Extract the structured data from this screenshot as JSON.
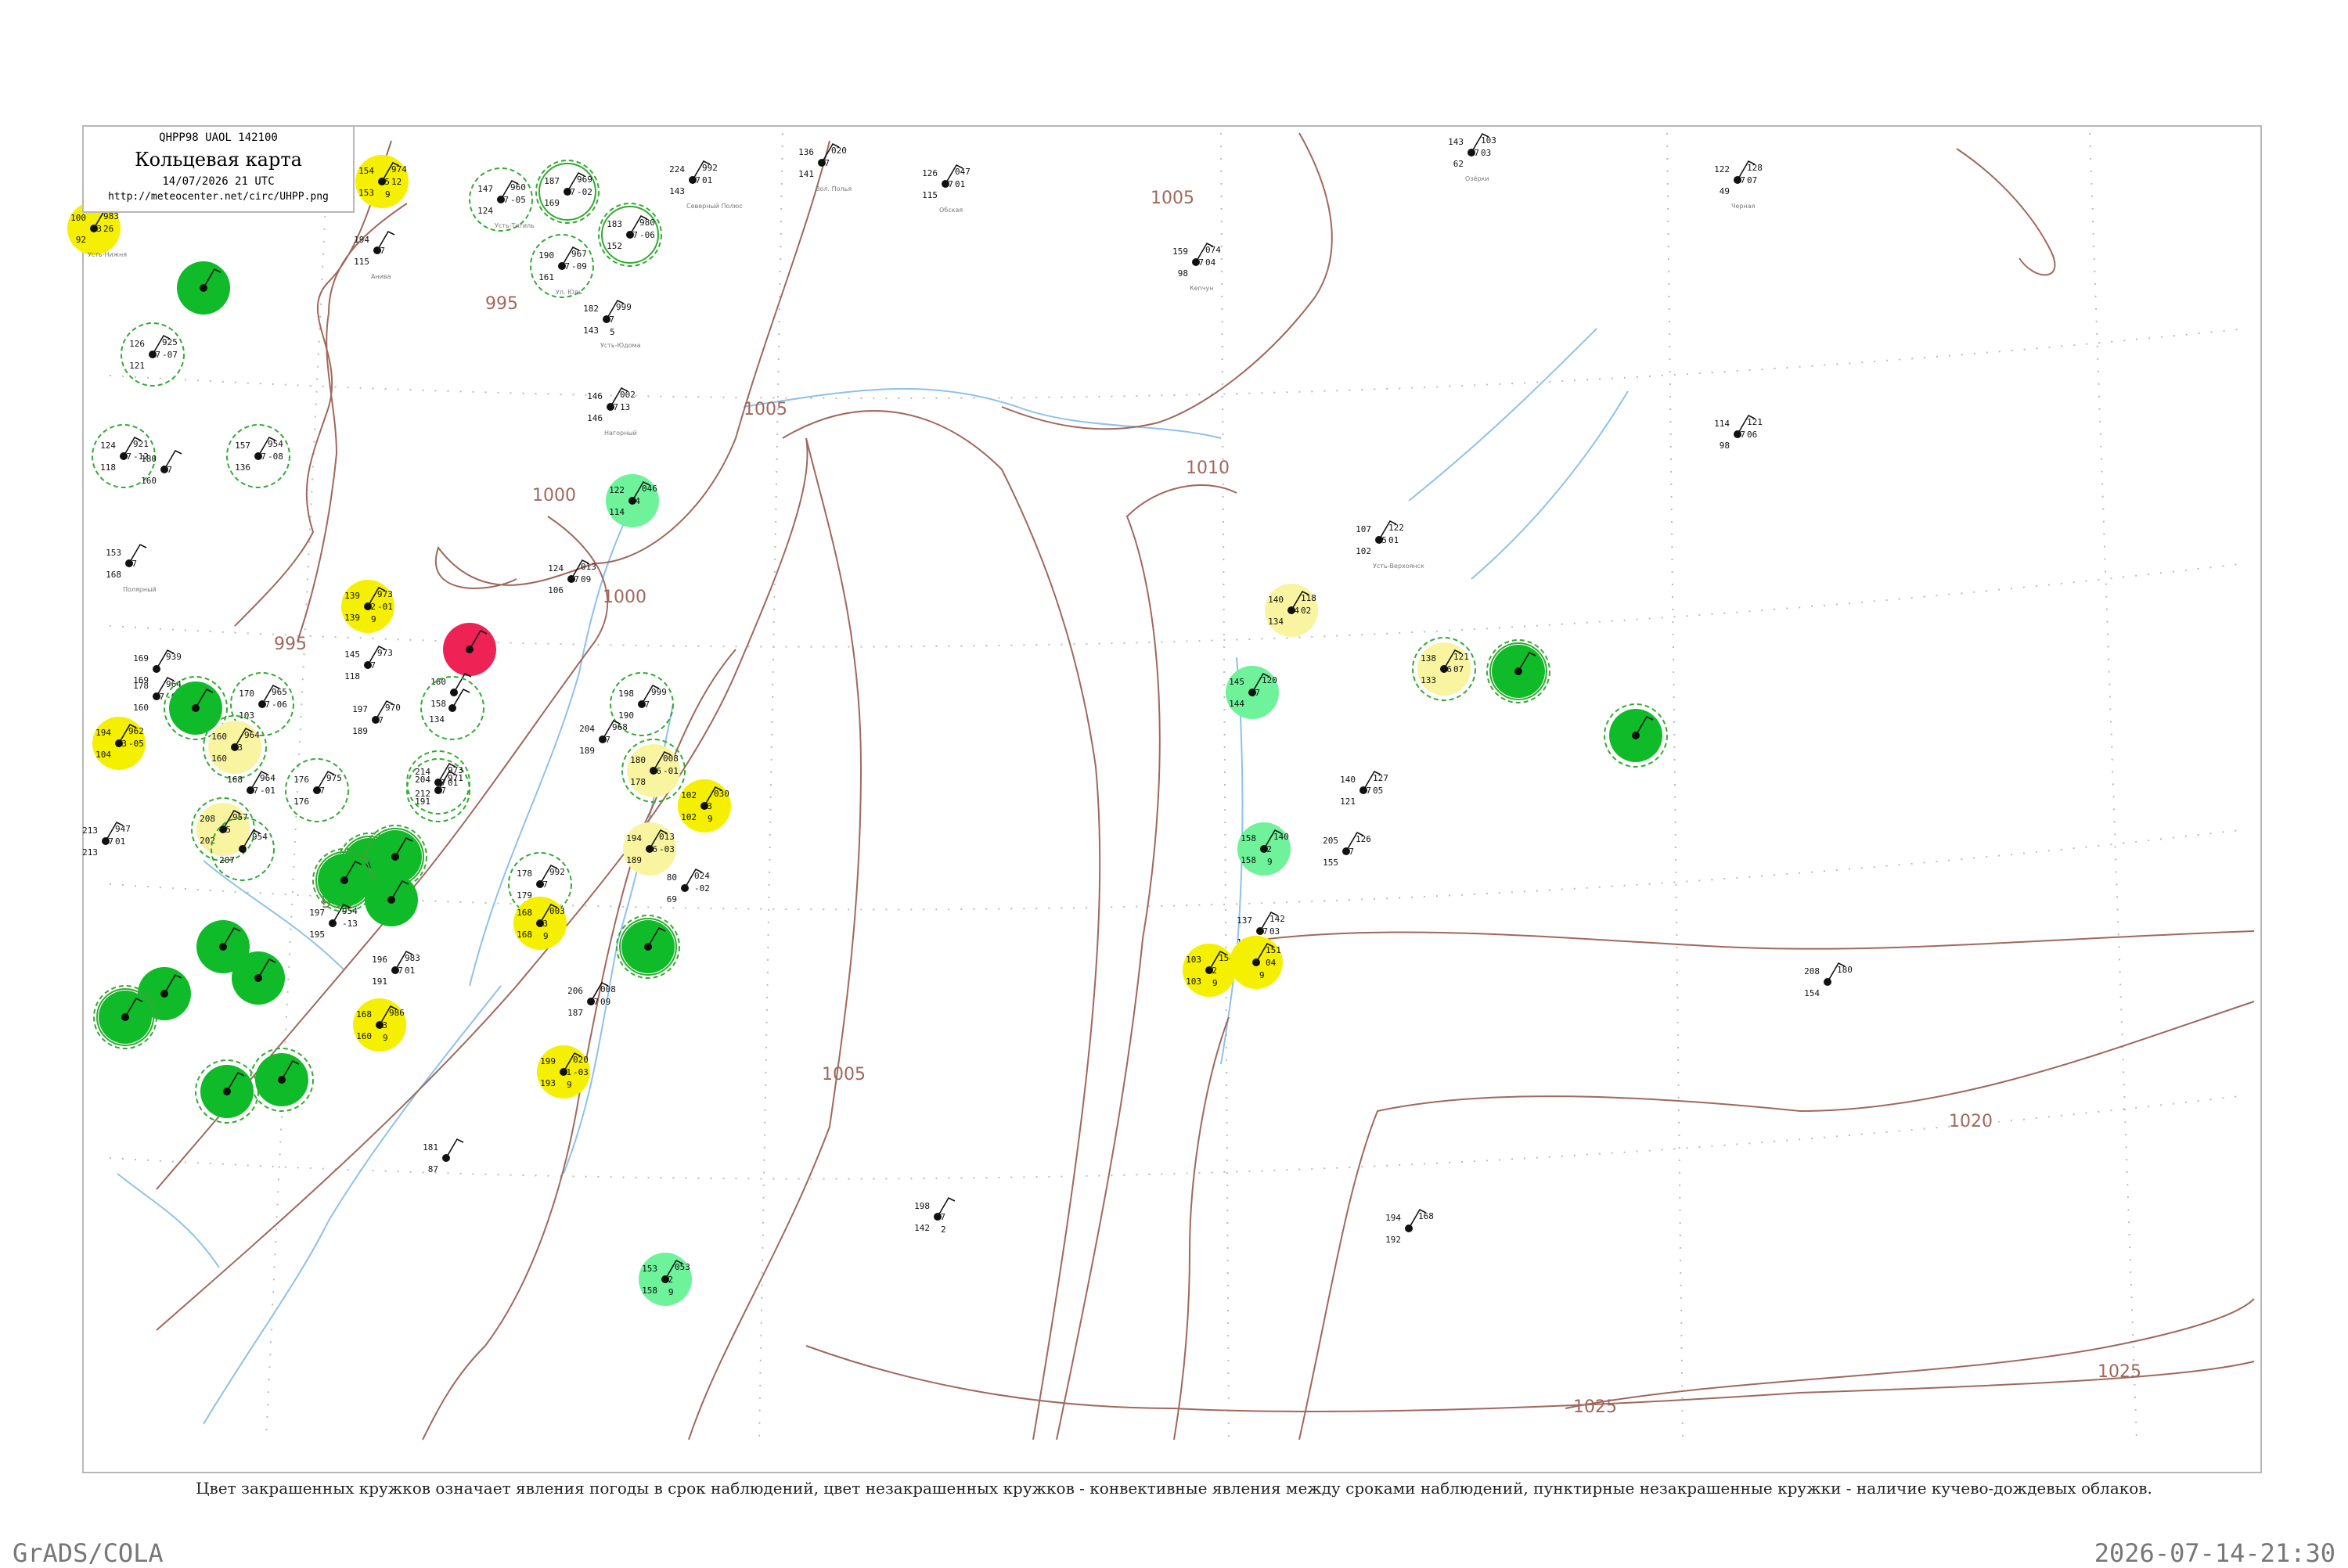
{
  "header": {
    "code": "QHPP98  UAOL  142100",
    "title": "Кольцевая карта",
    "datetime": "14/07/2026 21 UTC",
    "url": "http://meteocenter.net/circ/UHPP.png"
  },
  "caption": "Цвет закрашенных кружков означает явления погоды в срок наблюдений, цвет незакрашенных кружков - конвективные явления между сроками наблюдений, пунктирные незакрашенные кружки - наличие кучево-дождевых облаков.",
  "footer": {
    "left": "GrADS/COLA",
    "right": "2026-07-14-21:30"
  },
  "colors": {
    "frame": "#b8b8b8",
    "coast": "#a0685c",
    "isobar": "#a0685c",
    "river": "#8ec1ea",
    "yellow": "#f5f000",
    "pale_yellow": "#f8f4a0",
    "light_green": "#6ef29a",
    "green": "#10bb2a",
    "red": "#ee2255",
    "dashed_ring": "#33aa33"
  },
  "isobars": [
    {
      "value": "995",
      "label": "995"
    },
    {
      "value": "1000",
      "label": "1000"
    },
    {
      "value": "1005",
      "label": "1005"
    },
    {
      "value": "1010",
      "label": "1010"
    },
    {
      "value": "1020",
      "label": "1020"
    },
    {
      "value": "1025",
      "label": "1025"
    }
  ],
  "stations": [
    {
      "tl": "100",
      "tr": "983",
      "ml": "93",
      "mr": "26",
      "bl": "92",
      "br": "",
      "name": "Усть-Нижня",
      "fill": "yellow",
      "ring": ""
    },
    {
      "tl": "154",
      "tr": "974",
      "ml": "95",
      "mr": "12",
      "bl": "153",
      "br": "9",
      "name": "",
      "fill": "yellow",
      "ring": ""
    },
    {
      "tl": "194",
      "tr": "",
      "ml": "97",
      "mr": "",
      "bl": "115",
      "br": "",
      "name": "Анива",
      "fill": "",
      "ring": ""
    },
    {
      "tl": "147",
      "tr": "960",
      "ml": "97",
      "mr": "-05",
      "bl": "124",
      "br": "",
      "name": "Усть-Тигиль",
      "fill": "",
      "ring": "dashed"
    },
    {
      "tl": "187",
      "tr": "969",
      "ml": "97",
      "mr": "-02",
      "bl": "169",
      "br": "",
      "name": "",
      "fill": "",
      "ring": "double"
    },
    {
      "tl": "183",
      "tr": "980",
      "ml": "97",
      "mr": "-06",
      "bl": "152",
      "br": "",
      "name": "",
      "fill": "",
      "ring": "double"
    },
    {
      "tl": "190",
      "tr": "967",
      "ml": "97",
      "mr": "-09",
      "bl": "161",
      "br": "",
      "name": "Ул. Юдь",
      "fill": "",
      "ring": "dashed"
    },
    {
      "tl": "224",
      "tr": "992",
      "ml": "97",
      "mr": "01",
      "bl": "143",
      "br": "",
      "name": "Северный Полюс",
      "fill": "",
      "ring": ""
    },
    {
      "tl": "136",
      "tr": "020",
      "ml": "97",
      "mr": "",
      "bl": "141",
      "br": "",
      "name": "Вол. Полья",
      "fill": "",
      "ring": ""
    },
    {
      "tl": "126",
      "tr": "047",
      "ml": "97",
      "mr": "01",
      "bl": "115",
      "br": "",
      "name": "Обская",
      "fill": "",
      "ring": ""
    },
    {
      "tl": "159",
      "tr": "074",
      "ml": "97",
      "mr": "04",
      "bl": "98",
      "br": "",
      "name": "Кепчун",
      "fill": "",
      "ring": ""
    },
    {
      "tl": "143",
      "tr": "103",
      "ml": "97",
      "mr": "03",
      "bl": "62",
      "br": "",
      "name": "Озёрки",
      "fill": "",
      "ring": ""
    },
    {
      "tl": "122",
      "tr": "128",
      "ml": "97",
      "mr": "07",
      "bl": "49",
      "br": "",
      "name": "Черная",
      "fill": "",
      "ring": ""
    },
    {
      "tl": "",
      "tr": "",
      "ml": "",
      "mr": "",
      "bl": "",
      "br": "",
      "name": "",
      "fill": "green",
      "ring": ""
    },
    {
      "tl": "126",
      "tr": "925",
      "ml": "97",
      "mr": "-07",
      "bl": "121",
      "br": "",
      "name": "",
      "fill": "",
      "ring": "dashed"
    },
    {
      "tl": "182",
      "tr": "999",
      "ml": "97",
      "mr": "",
      "bl": "143",
      "br": "5",
      "name": "Усть-Юдома",
      "fill": "",
      "ring": ""
    },
    {
      "tl": "146",
      "tr": "002",
      "ml": "97",
      "mr": "13",
      "bl": "146",
      "br": "",
      "name": "Нагорный",
      "fill": "",
      "ring": ""
    },
    {
      "tl": "124",
      "tr": "921",
      "ml": "97",
      "mr": "-12",
      "bl": "118",
      "br": "",
      "name": "",
      "fill": "",
      "ring": "dashed"
    },
    {
      "tl": "180",
      "tr": "",
      "ml": "07",
      "mr": "",
      "bl": "160",
      "br": "",
      "name": "",
      "fill": "",
      "ring": ""
    },
    {
      "tl": "157",
      "tr": "954",
      "ml": "97",
      "mr": "-08",
      "bl": "136",
      "br": "",
      "name": "",
      "fill": "",
      "ring": "dashed"
    },
    {
      "tl": "122",
      "tr": "046",
      "ml": "94",
      "mr": "",
      "bl": "114",
      "br": "",
      "name": "",
      "fill": "light_green",
      "ring": ""
    },
    {
      "tl": "114",
      "tr": "121",
      "ml": "97",
      "mr": "06",
      "bl": "98",
      "br": "",
      "name": "",
      "fill": "",
      "ring": ""
    },
    {
      "tl": "107",
      "tr": "122",
      "ml": "95",
      "mr": "01",
      "bl": "102",
      "br": "",
      "name": "Усть-Верхоянск",
      "fill": "",
      "ring": ""
    },
    {
      "tl": "153",
      "tr": "",
      "ml": "97",
      "mr": "",
      "bl": "168",
      "br": "",
      "name": "Полярный",
      "fill": "",
      "ring": ""
    },
    {
      "tl": "124",
      "tr": "013",
      "ml": "97",
      "mr": "09",
      "bl": "106",
      "br": "",
      "name": "",
      "fill": "",
      "ring": ""
    },
    {
      "tl": "139",
      "tr": "973",
      "ml": "92",
      "mr": "-01",
      "bl": "139",
      "br": "9",
      "name": "",
      "fill": "yellow",
      "ring": ""
    },
    {
      "tl": "140",
      "tr": "118",
      "ml": "94",
      "mr": "02",
      "bl": "134",
      "br": "",
      "name": "",
      "fill": "pale_yellow",
      "ring": ""
    },
    {
      "tl": "169",
      "tr": "939",
      "ml": "",
      "mr": "",
      "bl": "169",
      "br": "",
      "name": "",
      "fill": "",
      "ring": ""
    },
    {
      "tl": "145",
      "tr": "973",
      "ml": "97",
      "mr": "",
      "bl": "118",
      "br": "",
      "name": "",
      "fill": "",
      "ring": ""
    },
    {
      "tl": "",
      "tr": "",
      "ml": "",
      "mr": "",
      "bl": "",
      "br": "",
      "name": "",
      "fill": "red",
      "ring": ""
    },
    {
      "tl": "178",
      "tr": "964",
      "ml": "97",
      "mr": "-08",
      "bl": "160",
      "br": "",
      "name": "",
      "fill": "",
      "ring": ""
    },
    {
      "tl": "",
      "tr": "",
      "ml": "",
      "mr": "",
      "bl": "",
      "br": "",
      "name": "",
      "fill": "green",
      "ring": "dashed"
    },
    {
      "tl": "170",
      "tr": "965",
      "ml": "97",
      "mr": "-06",
      "bl": "103",
      "br": "",
      "name": "",
      "fill": "",
      "ring": "dashed"
    },
    {
      "tl": "160",
      "tr": "",
      "ml": "",
      "mr": "",
      "bl": "158",
      "br": "",
      "name": "",
      "fill": "",
      "ring": ""
    },
    {
      "tl": "",
      "tr": "",
      "ml": "",
      "mr": "",
      "bl": "134",
      "br": "",
      "name": "",
      "fill": "",
      "ring": "dashed"
    },
    {
      "tl": "198",
      "tr": "999",
      "ml": "97",
      "mr": "",
      "bl": "190",
      "br": "",
      "name": "",
      "fill": "",
      "ring": "dashed"
    },
    {
      "tl": "145",
      "tr": "120",
      "ml": "97",
      "mr": "",
      "bl": "144",
      "br": "",
      "name": "",
      "fill": "light_green",
      "ring": ""
    },
    {
      "tl": "138",
      "tr": "121",
      "ml": "96",
      "mr": "07",
      "bl": "133",
      "br": "",
      "name": "",
      "fill": "pale_yellow",
      "ring": "dashed"
    },
    {
      "tl": "",
      "tr": "",
      "ml": "",
      "mr": "",
      "bl": "",
      "br": "",
      "name": "",
      "fill": "green",
      "ring": "double"
    },
    {
      "tl": "",
      "tr": "",
      "ml": "",
      "mr": "",
      "bl": "",
      "br": "",
      "name": "",
      "fill": "green",
      "ring": "dashed"
    },
    {
      "tl": "194",
      "tr": "962",
      "ml": "93",
      "mr": "-05",
      "bl": "104",
      "br": "",
      "name": "",
      "fill": "yellow",
      "ring": ""
    },
    {
      "tl": "160",
      "tr": "964",
      "ml": "93",
      "mr": "",
      "bl": "160",
      "br": "",
      "name": "",
      "fill": "pale_yellow",
      "ring": "dashed"
    },
    {
      "tl": "197",
      "tr": "970",
      "ml": "97",
      "mr": "",
      "bl": "189",
      "br": "",
      "name": "",
      "fill": "",
      "ring": ""
    },
    {
      "tl": "204",
      "tr": "968",
      "ml": "97",
      "mr": "",
      "bl": "189",
      "br": "",
      "name": "",
      "fill": "",
      "ring": ""
    },
    {
      "tl": "180",
      "tr": "008",
      "ml": "96",
      "mr": "-01",
      "bl": "178",
      "br": "",
      "name": "",
      "fill": "pale_yellow",
      "ring": "dashed"
    },
    {
      "tl": "204",
      "tr": "971",
      "ml": "97",
      "mr": "",
      "bl": "191",
      "br": "",
      "name": "",
      "fill": "",
      "ring": "dashed"
    },
    {
      "tl": "168",
      "tr": "964",
      "ml": "97",
      "mr": "-01",
      "bl": "",
      "br": "",
      "name": "",
      "fill": "",
      "ring": ""
    },
    {
      "tl": "176",
      "tr": "975",
      "ml": "97",
      "mr": "",
      "bl": "176",
      "br": "",
      "name": "",
      "fill": "",
      "ring": "dashed"
    },
    {
      "tl": "214",
      "tr": "973",
      "ml": "97",
      "mr": "01",
      "bl": "212",
      "br": "",
      "name": "",
      "fill": "",
      "ring": "dashed"
    },
    {
      "tl": "102",
      "tr": "030",
      "ml": "93",
      "mr": "",
      "bl": "102",
      "br": "9",
      "name": "",
      "fill": "yellow",
      "ring": ""
    },
    {
      "tl": "140",
      "tr": "127",
      "ml": "97",
      "mr": "05",
      "bl": "121",
      "br": "",
      "name": "",
      "fill": "",
      "ring": ""
    },
    {
      "tl": "208",
      "tr": "957",
      "ml": "95",
      "mr": "",
      "bl": "202",
      "br": "",
      "name": "",
      "fill": "pale_yellow",
      "ring": "dashed"
    },
    {
      "tl": "",
      "tr": "954",
      "ml": "",
      "mr": "",
      "bl": "207",
      "br": "",
      "name": "",
      "fill": "",
      "ring": "dashed"
    },
    {
      "tl": "213",
      "tr": "947",
      "ml": "97",
      "mr": "01",
      "bl": "213",
      "br": "",
      "name": "",
      "fill": "",
      "ring": ""
    },
    {
      "tl": "194",
      "tr": "013",
      "ml": "96",
      "mr": "-03",
      "bl": "189",
      "br": "",
      "name": "",
      "fill": "pale_yellow",
      "ring": ""
    },
    {
      "tl": "158",
      "tr": "140",
      "ml": "92",
      "mr": "",
      "bl": "158",
      "br": "9",
      "name": "",
      "fill": "light_green",
      "ring": ""
    },
    {
      "tl": "205",
      "tr": "126",
      "ml": "97",
      "mr": "",
      "bl": "155",
      "br": "",
      "name": "",
      "fill": "",
      "ring": ""
    },
    {
      "tl": "",
      "tr": "",
      "ml": "",
      "mr": "",
      "bl": "",
      "br": "",
      "name": "",
      "fill": "green",
      "ring": "double"
    },
    {
      "tl": "",
      "tr": "",
      "ml": "",
      "mr": "",
      "bl": "",
      "br": "",
      "name": "",
      "fill": "green",
      "ring": "double"
    },
    {
      "tl": "",
      "tr": "",
      "ml": "",
      "mr": "",
      "bl": "",
      "br": "",
      "name": "",
      "fill": "green",
      "ring": "double"
    },
    {
      "tl": "",
      "tr": "",
      "ml": "",
      "mr": "",
      "bl": "",
      "br": "",
      "name": "",
      "fill": "green",
      "ring": ""
    },
    {
      "tl": "178",
      "tr": "992",
      "ml": "97",
      "mr": "",
      "bl": "179",
      "br": "",
      "name": "",
      "fill": "",
      "ring": "dashed"
    },
    {
      "tl": "80",
      "tr": "024",
      "ml": "",
      "mr": "-02",
      "bl": "69",
      "br": "",
      "name": "",
      "fill": "",
      "ring": ""
    },
    {
      "tl": "197",
      "tr": "954",
      "ml": "",
      "mr": "-13",
      "bl": "195",
      "br": "",
      "name": "",
      "fill": "",
      "ring": ""
    },
    {
      "tl": "168",
      "tr": "003",
      "ml": "93",
      "mr": "",
      "bl": "168",
      "br": "9",
      "name": "",
      "fill": "yellow",
      "ring": ""
    },
    {
      "tl": "137",
      "tr": "142",
      "ml": "97",
      "mr": "03",
      "bl": "132",
      "br": "",
      "name": "",
      "fill": "",
      "ring": ""
    },
    {
      "tl": "",
      "tr": "",
      "ml": "",
      "mr": "",
      "bl": "",
      "br": "",
      "name": "",
      "fill": "green",
      "ring": ""
    },
    {
      "tl": "",
      "tr": "",
      "ml": "",
      "mr": "",
      "bl": "",
      "br": "",
      "name": "",
      "fill": "green",
      "ring": ""
    },
    {
      "tl": "",
      "tr": "",
      "ml": "",
      "mr": "",
      "bl": "",
      "br": "",
      "name": "",
      "fill": "green",
      "ring": ""
    },
    {
      "tl": "",
      "tr": "",
      "ml": "",
      "mr": "",
      "bl": "",
      "br": "",
      "name": "",
      "fill": "green",
      "ring": "double"
    },
    {
      "tl": "",
      "tr": "",
      "ml": "",
      "mr": "",
      "bl": "",
      "br": "",
      "name": "",
      "fill": "green",
      "ring": "dashed"
    },
    {
      "tl": "196",
      "tr": "983",
      "ml": "97",
      "mr": "01",
      "bl": "191",
      "br": "",
      "name": "",
      "fill": "",
      "ring": ""
    },
    {
      "tl": "103",
      "tr": "154",
      "ml": "92",
      "mr": "",
      "bl": "103",
      "br": "9",
      "name": "",
      "fill": "yellow",
      "ring": ""
    },
    {
      "tl": "",
      "tr": "151",
      "ml": "",
      "mr": "04",
      "bl": "",
      "br": "9",
      "name": "",
      "fill": "yellow",
      "ring": ""
    },
    {
      "tl": "208",
      "tr": "180",
      "ml": "",
      "mr": "",
      "bl": "154",
      "br": "",
      "name": "",
      "fill": "",
      "ring": ""
    },
    {
      "tl": "206",
      "tr": "008",
      "ml": "97",
      "mr": "09",
      "bl": "187",
      "br": "",
      "name": "",
      "fill": "",
      "ring": ""
    },
    {
      "tl": "168",
      "tr": "986",
      "ml": "93",
      "mr": "",
      "bl": "160",
      "br": "9",
      "name": "",
      "fill": "yellow",
      "ring": ""
    },
    {
      "tl": "199",
      "tr": "020",
      "ml": "91",
      "mr": "-03",
      "bl": "193",
      "br": "9",
      "name": "",
      "fill": "yellow",
      "ring": ""
    },
    {
      "tl": "",
      "tr": "",
      "ml": "",
      "mr": "",
      "bl": "",
      "br": "",
      "name": "",
      "fill": "green",
      "ring": "double"
    },
    {
      "tl": "",
      "tr": "",
      "ml": "",
      "mr": "",
      "bl": "",
      "br": "",
      "name": "",
      "fill": "green",
      "ring": "dashed"
    },
    {
      "tl": "181",
      "tr": "",
      "ml": "",
      "mr": "",
      "bl": "87",
      "br": "",
      "name": "",
      "fill": "",
      "ring": ""
    },
    {
      "tl": "198",
      "tr": "",
      "ml": "97",
      "mr": "",
      "bl": "142",
      "br": "2",
      "name": "",
      "fill": "",
      "ring": ""
    },
    {
      "tl": "194",
      "tr": "168",
      "ml": "",
      "mr": "",
      "bl": "192",
      "br": "",
      "name": "",
      "fill": "",
      "ring": ""
    },
    {
      "tl": "153",
      "tr": "053",
      "ml": "92",
      "mr": "",
      "bl": "158",
      "br": "9",
      "name": "",
      "fill": "light_green",
      "ring": ""
    }
  ]
}
